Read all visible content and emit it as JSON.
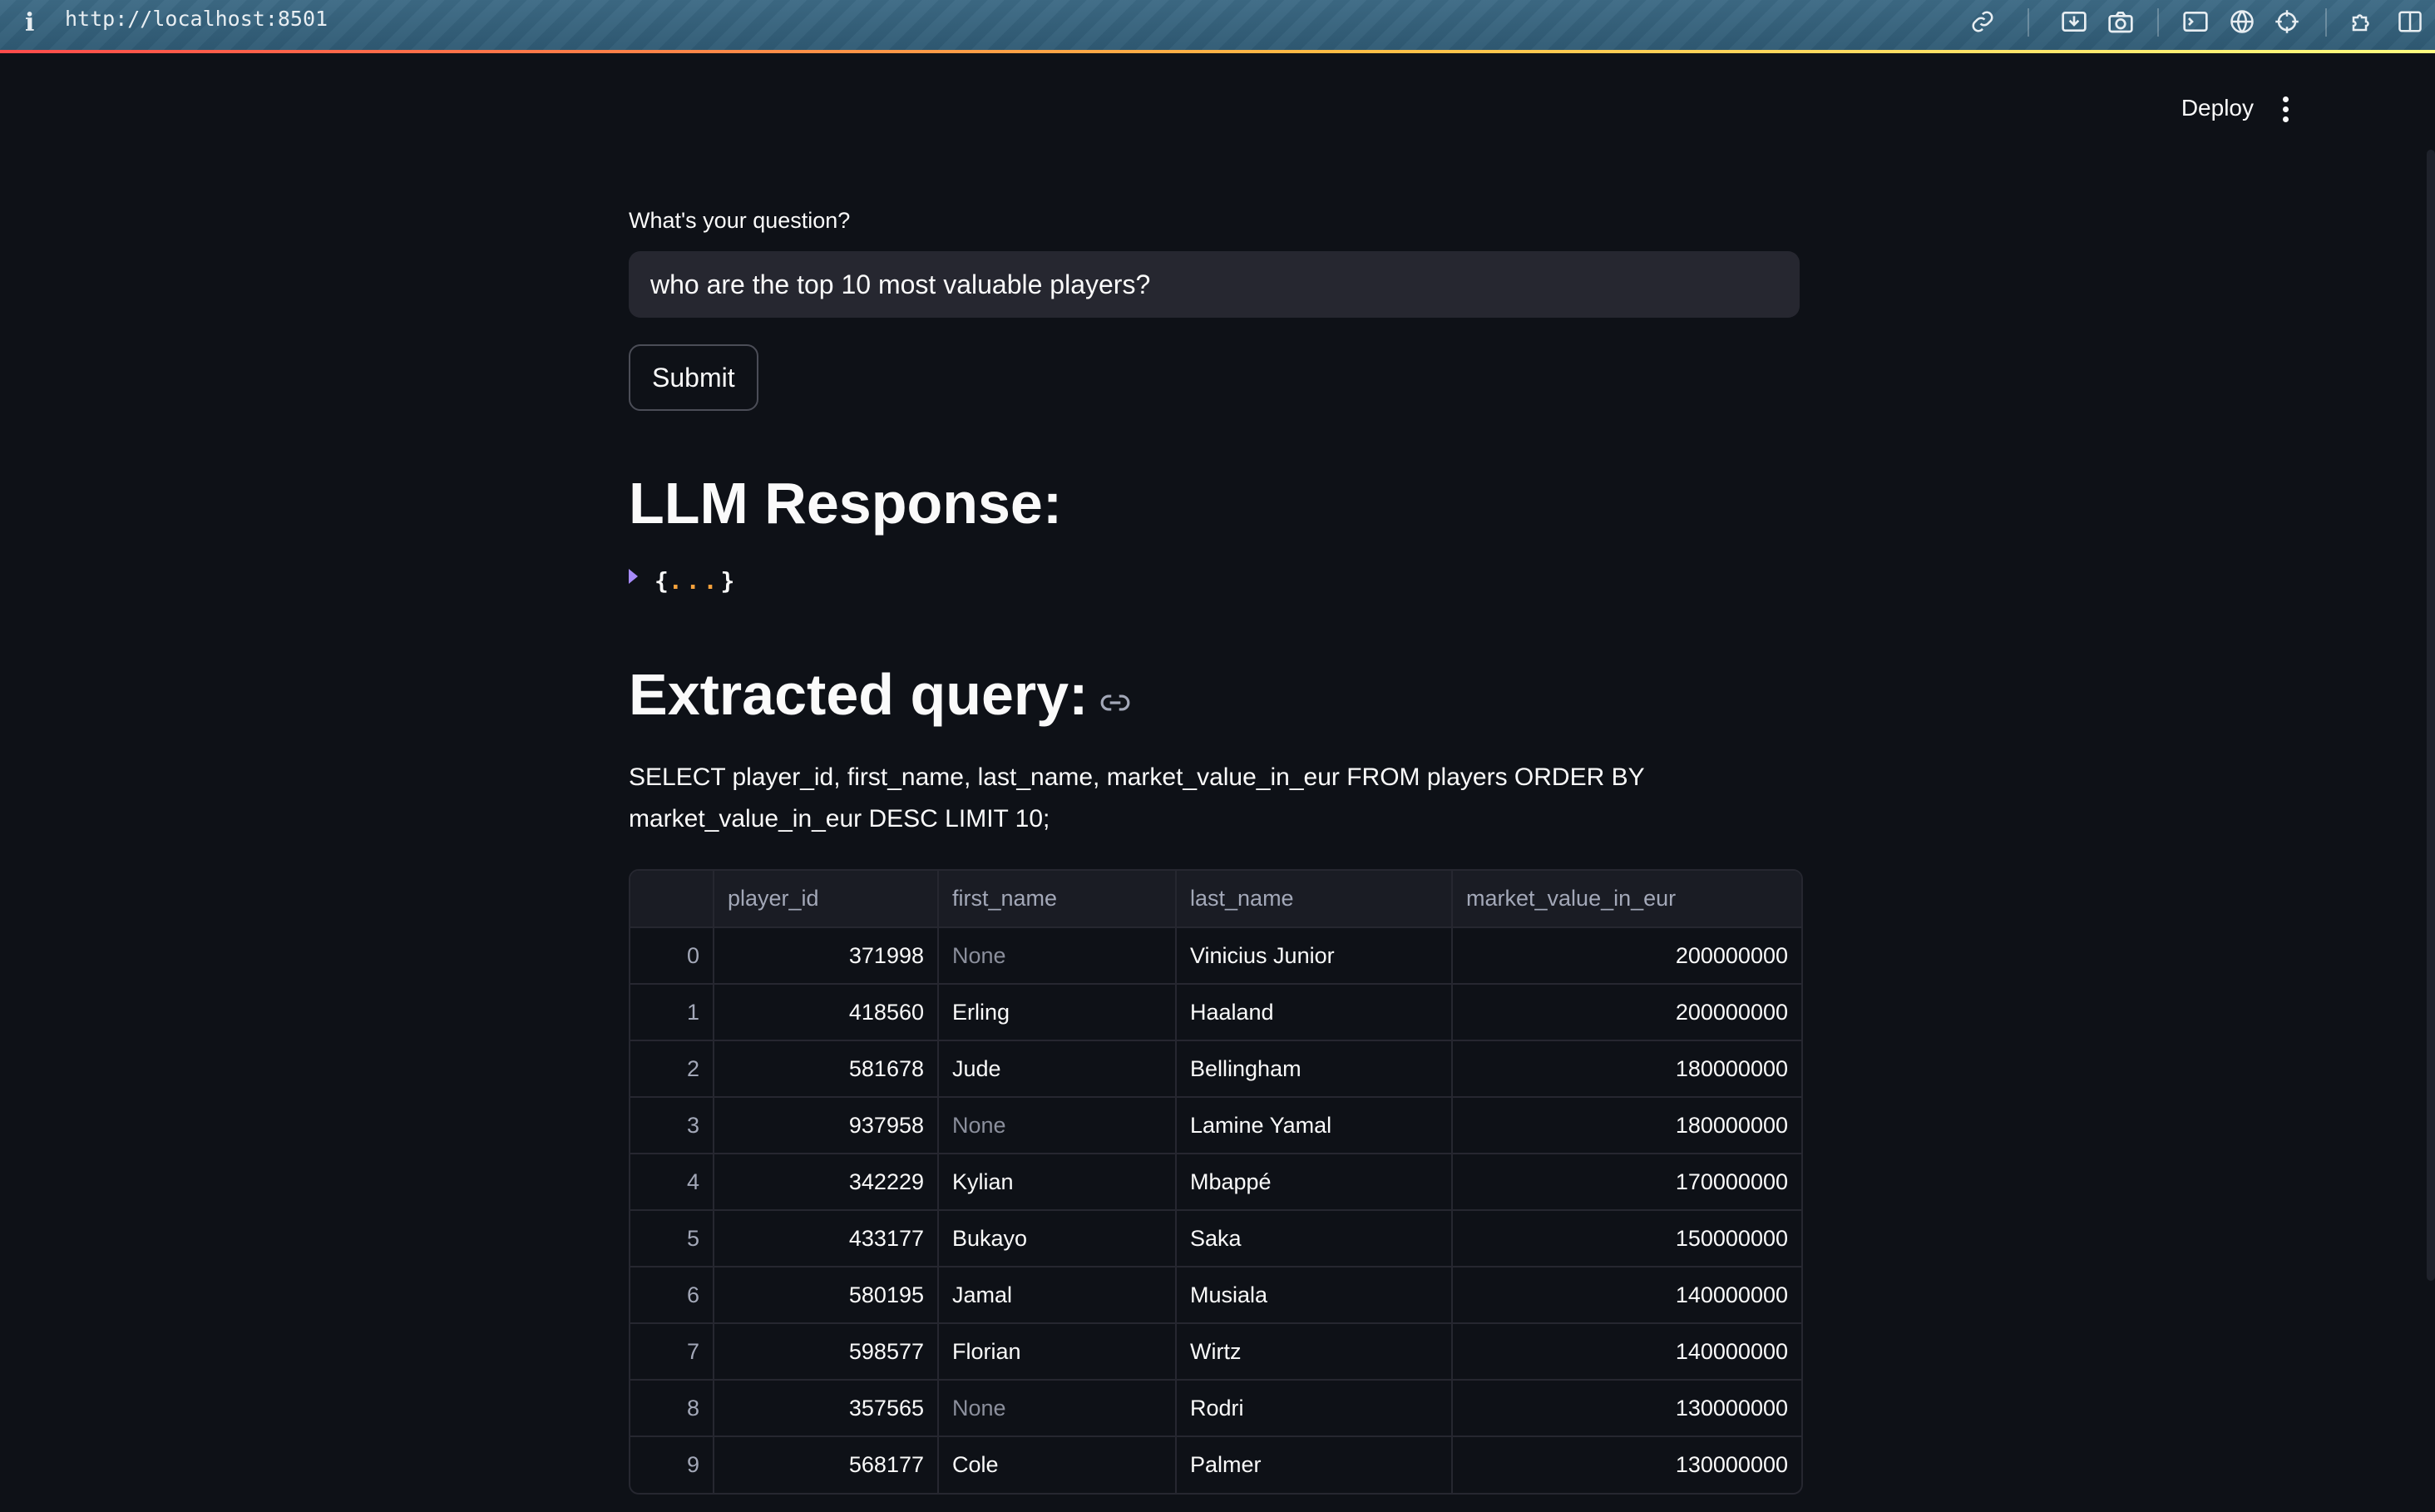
{
  "browser": {
    "info_icon": "i",
    "url": "http://localhost:8501",
    "icons": [
      "link-icon",
      "download-icon",
      "camera-icon",
      "terminal-icon",
      "globe-icon",
      "crosshair-icon",
      "puzzle-icon",
      "sidebar-icon"
    ]
  },
  "header": {
    "deploy_label": "Deploy",
    "menu_icon": "kebab-menu-icon"
  },
  "form": {
    "question_label": "What's your question?",
    "question_value": "who are the top 10 most valuable players?",
    "submit_label": "Submit"
  },
  "llm": {
    "heading": "LLM Response:",
    "json_open": "{",
    "json_dots": "...",
    "json_close": "}"
  },
  "query": {
    "heading": "Extracted query:",
    "sql": "SELECT player_id, first_name, last_name, market_value_in_eur FROM players ORDER BY market_value_in_eur DESC LIMIT 10;"
  },
  "table": {
    "columns": [
      "",
      "player_id",
      "first_name",
      "last_name",
      "market_value_in_eur"
    ],
    "rows": [
      [
        "0",
        "371998",
        "None",
        "Vinicius Junior",
        "200000000"
      ],
      [
        "1",
        "418560",
        "Erling",
        "Haaland",
        "200000000"
      ],
      [
        "2",
        "581678",
        "Jude",
        "Bellingham",
        "180000000"
      ],
      [
        "3",
        "937958",
        "None",
        "Lamine Yamal",
        "180000000"
      ],
      [
        "4",
        "342229",
        "Kylian",
        "Mbappé",
        "170000000"
      ],
      [
        "5",
        "433177",
        "Bukayo",
        "Saka",
        "150000000"
      ],
      [
        "6",
        "580195",
        "Jamal",
        "Musiala",
        "140000000"
      ],
      [
        "7",
        "598577",
        "Florian",
        "Wirtz",
        "140000000"
      ],
      [
        "8",
        "357565",
        "None",
        "Rodri",
        "130000000"
      ],
      [
        "9",
        "568177",
        "Cole",
        "Palmer",
        "130000000"
      ]
    ]
  },
  "colors": {
    "background": "#0e1117",
    "input_bg": "#262730",
    "accent_start": "#ff4b4b",
    "accent_end": "#fffd80",
    "toggle": "#a78bfa"
  }
}
